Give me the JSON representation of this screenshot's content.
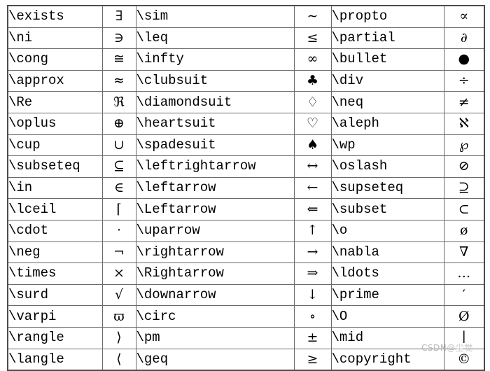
{
  "document": {
    "kind": "latex-symbol-reference-table",
    "columns": 6,
    "rows": 17,
    "pair_count": 3
  },
  "table": {
    "rows": [
      {
        "cmd1": "\\exists",
        "sym1": "∃",
        "cmd2": "\\sim",
        "sym2": "∼",
        "cmd3": "\\propto",
        "sym3": "∝"
      },
      {
        "cmd1": "\\ni",
        "sym1": "∋",
        "cmd2": "\\leq",
        "sym2": "≤",
        "cmd3": "\\partial",
        "sym3": "∂"
      },
      {
        "cmd1": "\\cong",
        "sym1": "≅",
        "cmd2": "\\infty",
        "sym2": "∞",
        "cmd3": "\\bullet",
        "sym3": "●"
      },
      {
        "cmd1": "\\approx",
        "sym1": "≈",
        "cmd2": "\\clubsuit",
        "sym2": "♣",
        "cmd3": "\\div",
        "sym3": "÷"
      },
      {
        "cmd1": "\\Re",
        "sym1": "ℜ",
        "cmd2": "\\diamondsuit",
        "sym2": "♢",
        "cmd3": "\\neq",
        "sym3": "≠"
      },
      {
        "cmd1": "\\oplus",
        "sym1": "⊕",
        "cmd2": "\\heartsuit",
        "sym2": "♡",
        "cmd3": "\\aleph",
        "sym3": "ℵ"
      },
      {
        "cmd1": "\\cup",
        "sym1": "∪",
        "cmd2": "\\spadesuit",
        "sym2": "♠",
        "cmd3": "\\wp",
        "sym3": "℘"
      },
      {
        "cmd1": "\\subseteq",
        "sym1": "⊆",
        "cmd2": "\\leftrightarrow",
        "sym2": "↔",
        "cmd3": "\\oslash",
        "sym3": "⊘"
      },
      {
        "cmd1": "\\in",
        "sym1": "∈",
        "cmd2": "\\leftarrow",
        "sym2": "←",
        "cmd3": "\\supseteq",
        "sym3": "⊇"
      },
      {
        "cmd1": "\\lceil",
        "sym1": "⌈",
        "cmd2": "\\Leftarrow",
        "sym2": "⇐",
        "cmd3": "\\subset",
        "sym3": "⊂"
      },
      {
        "cmd1": "\\cdot",
        "sym1": "·",
        "cmd2": "\\uparrow",
        "sym2": "↑",
        "cmd3": "\\o",
        "sym3": "ø"
      },
      {
        "cmd1": "\\neg",
        "sym1": "¬",
        "cmd2": "\\rightarrow",
        "sym2": "→",
        "cmd3": "\\nabla",
        "sym3": "∇"
      },
      {
        "cmd1": "\\times",
        "sym1": "×",
        "cmd2": "\\Rightarrow",
        "sym2": "⇒",
        "cmd3": "\\ldots",
        "sym3": "…"
      },
      {
        "cmd1": "\\surd",
        "sym1": "√",
        "cmd2": "\\downarrow",
        "sym2": "↓",
        "cmd3": "\\prime",
        "sym3": "′"
      },
      {
        "cmd1": "\\varpi",
        "sym1": "ϖ",
        "cmd2": "\\circ",
        "sym2": "∘",
        "cmd3": "\\O",
        "sym3": "Ø"
      },
      {
        "cmd1": "\\rangle",
        "sym1": "⟩",
        "cmd2": "\\pm",
        "sym2": "±",
        "cmd3": "\\mid",
        "sym3": "∣"
      },
      {
        "cmd1": "\\langle",
        "sym1": "⟨",
        "cmd2": "\\geq",
        "sym2": "≥",
        "cmd3": "\\copyright",
        "sym3": "©"
      }
    ]
  },
  "watermark": {
    "brand": "CSDN",
    "author": "@尘觉",
    "color": "#b9b9b9"
  }
}
